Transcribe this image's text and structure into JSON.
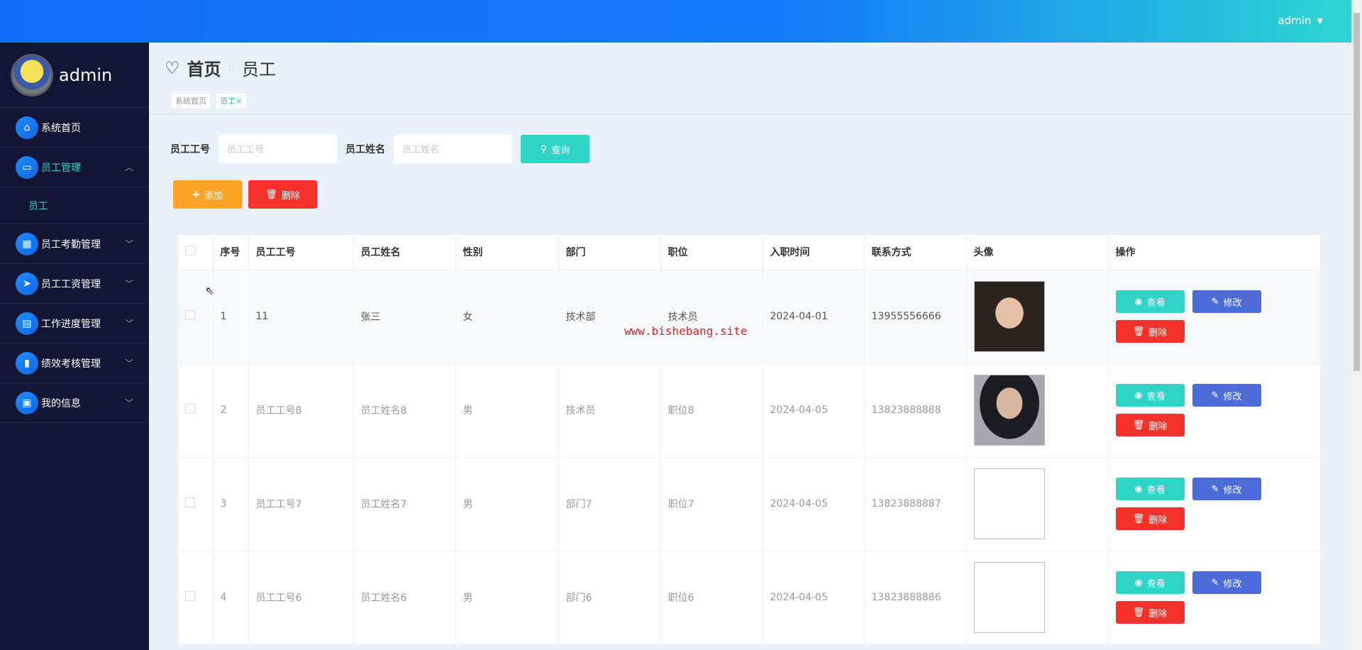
{
  "header": {
    "user": "admin"
  },
  "sidebar": {
    "profile_name": "admin",
    "items": [
      {
        "label": "系统首页",
        "icon": "⌂"
      },
      {
        "label": "员工管理",
        "icon": "▭"
      },
      {
        "label": "员工"
      },
      {
        "label": "员工考勤管理",
        "icon": "▦"
      },
      {
        "label": "员工工资管理",
        "icon": "➤"
      },
      {
        "label": "工作进度管理",
        "icon": "▤"
      },
      {
        "label": "绩效考核管理",
        "icon": "▮"
      },
      {
        "label": "我的信息",
        "icon": "▣"
      }
    ]
  },
  "page": {
    "title_home": "首页",
    "title_sep": "::",
    "title_current": "员工",
    "tags": [
      "系统首页",
      "员工×"
    ]
  },
  "search": {
    "label_id": "员工工号",
    "placeholder_id": "员工工号",
    "label_name": "员工姓名",
    "placeholder_name": "员工姓名",
    "search_label": "查询"
  },
  "actions": {
    "add": "添加",
    "delete": "删除"
  },
  "table": {
    "headers": [
      "序号",
      "员工工号",
      "员工姓名",
      "性别",
      "部门",
      "职位",
      "入职时间",
      "联系方式",
      "头像",
      "操作"
    ],
    "rows": [
      [
        "1",
        "11",
        "张三",
        "女",
        "技术部",
        "技术员",
        "2024-04-01",
        "13955556666"
      ],
      [
        "2",
        "员工工号8",
        "员工姓名8",
        "男",
        "技术员",
        "职位8",
        "2024-04-05",
        "13823888888"
      ],
      [
        "3",
        "员工工号7",
        "员工姓名7",
        "男",
        "部门7",
        "职位7",
        "2024-04-05",
        "13823888887"
      ],
      [
        "4",
        "员工工号6",
        "员工姓名6",
        "男",
        "部门6",
        "职位6",
        "2024-04-05",
        "13823888886"
      ]
    ],
    "op_view": "查看",
    "op_edit": "修改",
    "op_delete": "删除"
  },
  "watermark": "www.bishebang.site"
}
